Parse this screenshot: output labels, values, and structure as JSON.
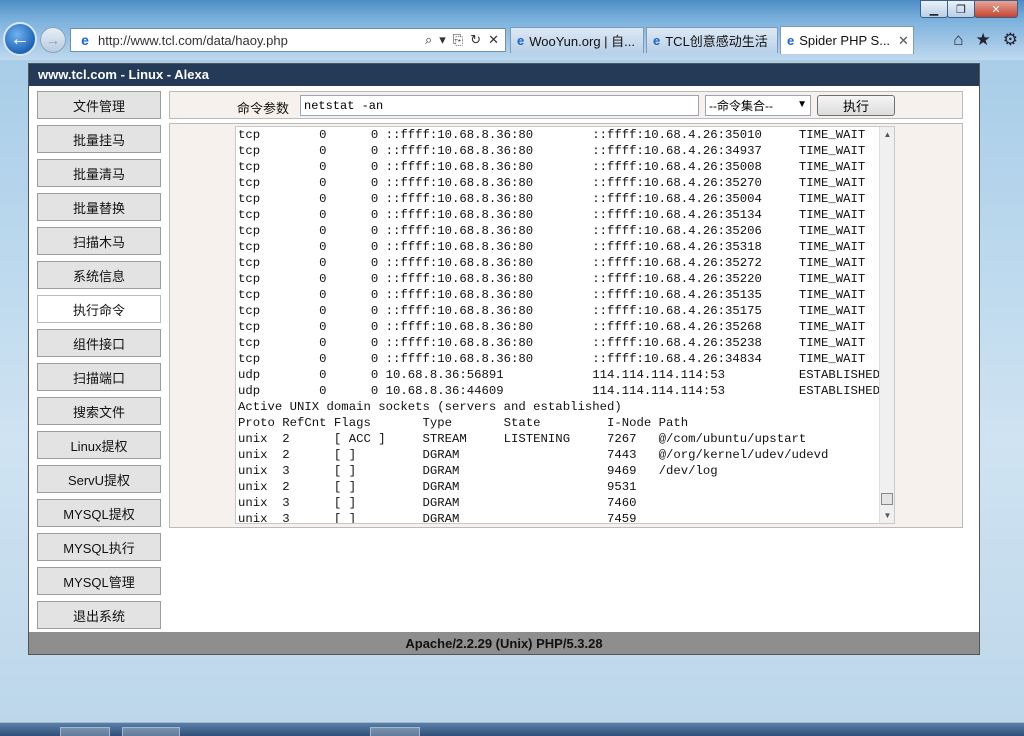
{
  "browser": {
    "url": "http://www.tcl.com/data/haoy.php",
    "tabs": [
      {
        "label": "WooYun.org | 自..."
      },
      {
        "label": "TCL创意感动生活"
      },
      {
        "label": "Spider PHP S..."
      }
    ],
    "icons": {
      "back": "←",
      "forward": "→",
      "search": "⌕",
      "dropdown": "▾",
      "compat": "⎘",
      "refresh": "↻",
      "stop": "✕",
      "home": "⌂",
      "favorites": "★",
      "tools": "⚙",
      "minimize": "▁",
      "maximize": "❐",
      "close": "✕",
      "tab_close": "✕"
    }
  },
  "header": {
    "title": "www.tcl.com - Linux - Alexa"
  },
  "sidebar": {
    "items": [
      {
        "label": "文件管理"
      },
      {
        "label": "批量挂马"
      },
      {
        "label": "批量清马"
      },
      {
        "label": "批量替换"
      },
      {
        "label": "扫描木马"
      },
      {
        "label": "系统信息"
      },
      {
        "label": "执行命令",
        "active": true
      },
      {
        "label": "组件接口"
      },
      {
        "label": "扫描端口"
      },
      {
        "label": "搜索文件"
      },
      {
        "label": "Linux提权"
      },
      {
        "label": "ServU提权"
      },
      {
        "label": "MYSQL提权"
      },
      {
        "label": "MYSQL执行"
      },
      {
        "label": "MYSQL管理"
      },
      {
        "label": "退出系统"
      }
    ]
  },
  "command": {
    "label": "命令参数",
    "value": "netstat -an",
    "select": "--命令集合--",
    "select_caret": "▼",
    "execute": "执行"
  },
  "output": {
    "lines": [
      "tcp        0      0 ::ffff:10.68.8.36:80        ::ffff:10.68.4.26:35010     TIME_WAIT",
      "tcp        0      0 ::ffff:10.68.8.36:80        ::ffff:10.68.4.26:34937     TIME_WAIT",
      "tcp        0      0 ::ffff:10.68.8.36:80        ::ffff:10.68.4.26:35008     TIME_WAIT",
      "tcp        0      0 ::ffff:10.68.8.36:80        ::ffff:10.68.4.26:35270     TIME_WAIT",
      "tcp        0      0 ::ffff:10.68.8.36:80        ::ffff:10.68.4.26:35004     TIME_WAIT",
      "tcp        0      0 ::ffff:10.68.8.36:80        ::ffff:10.68.4.26:35134     TIME_WAIT",
      "tcp        0      0 ::ffff:10.68.8.36:80        ::ffff:10.68.4.26:35206     TIME_WAIT",
      "tcp        0      0 ::ffff:10.68.8.36:80        ::ffff:10.68.4.26:35318     TIME_WAIT",
      "tcp        0      0 ::ffff:10.68.8.36:80        ::ffff:10.68.4.26:35272     TIME_WAIT",
      "tcp        0      0 ::ffff:10.68.8.36:80        ::ffff:10.68.4.26:35220     TIME_WAIT",
      "tcp        0      0 ::ffff:10.68.8.36:80        ::ffff:10.68.4.26:35135     TIME_WAIT",
      "tcp        0      0 ::ffff:10.68.8.36:80        ::ffff:10.68.4.26:35175     TIME_WAIT",
      "tcp        0      0 ::ffff:10.68.8.36:80        ::ffff:10.68.4.26:35268     TIME_WAIT",
      "tcp        0      0 ::ffff:10.68.8.36:80        ::ffff:10.68.4.26:35238     TIME_WAIT",
      "tcp        0      0 ::ffff:10.68.8.36:80        ::ffff:10.68.4.26:34834     TIME_WAIT",
      "udp        0      0 10.68.8.36:56891            114.114.114.114:53          ESTABLISHED",
      "udp        0      0 10.68.8.36:44609            114.114.114.114:53          ESTABLISHED",
      "Active UNIX domain sockets (servers and established)",
      "Proto RefCnt Flags       Type       State         I-Node Path",
      "unix  2      [ ACC ]     STREAM     LISTENING     7267   @/com/ubuntu/upstart",
      "unix  2      [ ]         DGRAM                    7443   @/org/kernel/udev/udevd",
      "unix  3      [ ]         DGRAM                    9469   /dev/log",
      "unix  2      [ ]         DGRAM                    9531",
      "unix  3      [ ]         DGRAM                    7460",
      "unix  3      [ ]         DGRAM                    7459"
    ]
  },
  "footer": {
    "text": "Apache/2.2.29 (Unix) PHP/5.3.28"
  },
  "colors": {
    "header_bg": "#243a57",
    "footer_bg": "#8e8e8e",
    "panel_bg": "#f6f1ec"
  }
}
